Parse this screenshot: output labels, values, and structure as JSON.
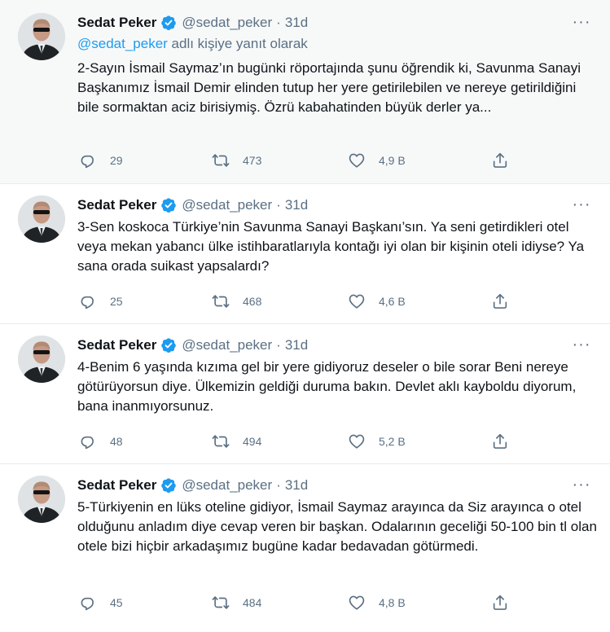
{
  "tweets": [
    {
      "name": "Sedat Peker",
      "handle": "@sedat_peker",
      "dot": "·",
      "time": "31d",
      "replying_mention": "@sedat_peker",
      "replying_rest": " adlı kişiye yanıt olarak",
      "text": "2-Sayın İsmail Saymaz’ın bugünki röportajında şunu öğrendik ki, Savunma Sanayi Başkanımız İsmail Demir elinden tutup her yere getirilebilen ve nereye getirildiğini bile sormaktan aciz birisiymiş. Özrü kabahatinden büyük derler ya...",
      "replies": "29",
      "retweets": "473",
      "likes": "4,9 B"
    },
    {
      "name": "Sedat Peker",
      "handle": "@sedat_peker",
      "dot": "·",
      "time": "31d",
      "text": "3-Sen koskoca Türkiye’nin Savunma Sanayi Başkanı’sın. Ya seni getirdikleri otel veya mekan yabancı ülke istihbaratlarıyla kontağı iyi olan bir kişinin oteli idiyse? Ya sana orada suikast yapsalardı?",
      "replies": "25",
      "retweets": "468",
      "likes": "4,6 B"
    },
    {
      "name": "Sedat Peker",
      "handle": "@sedat_peker",
      "dot": "·",
      "time": "31d",
      "text": "4-Benim 6 yaşında kızıma gel bir yere gidiyoruz deseler o bile sorar Beni nereye götürüyorsun diye. Ülkemizin geldiği duruma bakın. Devlet aklı kayboldu diyorum, bana inanmıyorsunuz.",
      "replies": "48",
      "retweets": "494",
      "likes": "5,2 B"
    },
    {
      "name": "Sedat Peker",
      "handle": "@sedat_peker",
      "dot": "·",
      "time": "31d",
      "text": "5-Türkiyenin en lüks oteline gidiyor, İsmail Saymaz arayınca da Siz arayınca o otel olduğunu anladım diye cevap veren bir başkan. Odalarının geceliği 50-100 bin tl olan otele bizi hiçbir arkadaşımız bugüne kadar bedavadan götürmedi.",
      "replies": "45",
      "retweets": "484",
      "likes": "4,8 B"
    }
  ],
  "colors": {
    "accent": "#1d9bf0",
    "secondary_text": "#5b7083",
    "highlight_bg": "#f7f9f9",
    "divider": "#e6ecf0"
  },
  "icons": [
    "verified-badge-icon",
    "more-options-icon",
    "reply-icon",
    "retweet-icon",
    "like-icon",
    "share-icon"
  ]
}
